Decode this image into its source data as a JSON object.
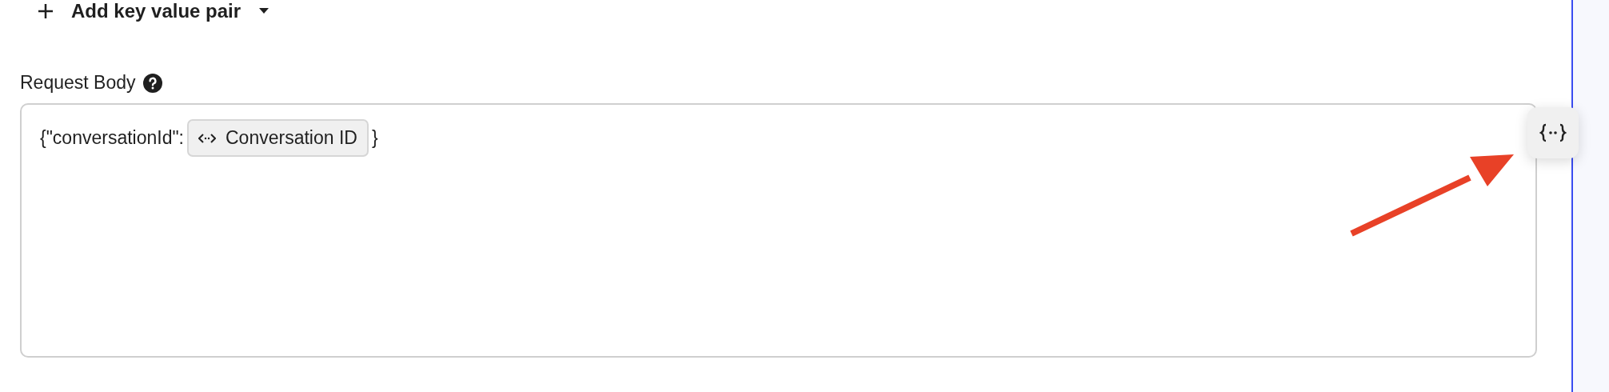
{
  "add_pair": {
    "label": "Add key value pair"
  },
  "request_body": {
    "label": "Request Body",
    "parts": [
      {
        "kind": "text",
        "text": "{\"conversationId\":"
      },
      {
        "kind": "variable",
        "label": "Conversation ID"
      },
      {
        "kind": "text",
        "text": "}"
      }
    ]
  }
}
